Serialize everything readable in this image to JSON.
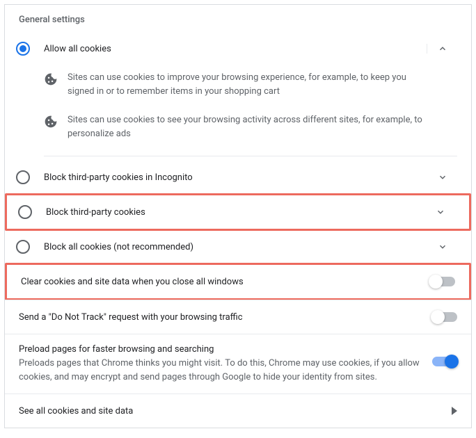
{
  "sectionTitle": "General settings",
  "options": {
    "allowAll": "Allow all cookies",
    "blockThirdIncognito": "Block third-party cookies in Incognito",
    "blockThird": "Block third-party cookies",
    "blockAll": "Block all cookies (not recommended)"
  },
  "allowDetails": {
    "line1": "Sites can use cookies to improve your browsing experience, for example, to keep you signed in or to remember items in your shopping cart",
    "line2": "Sites can use cookies to see your browsing activity across different sites, for example, to personalize ads"
  },
  "toggles": {
    "clearOnClose": "Clear cookies and site data when you close all windows",
    "doNotTrack": "Send a \"Do Not Track\" request with your browsing traffic",
    "preloadTitle": "Preload pages for faster browsing and searching",
    "preloadDesc": "Preloads pages that Chrome thinks you might visit. To do this, Chrome may use cookies, if you allow cookies, and may encrypt and send pages through Google to hide your identity from sites."
  },
  "seeAll": "See all cookies and site data"
}
